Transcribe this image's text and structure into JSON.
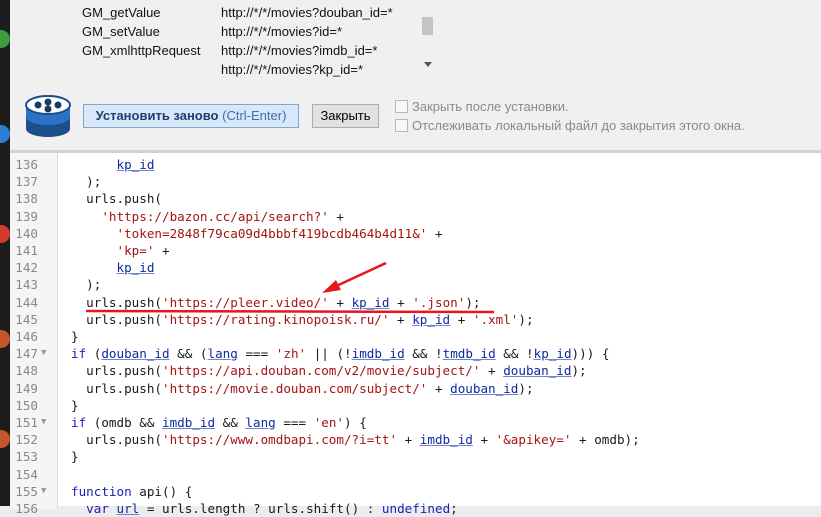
{
  "apis": [
    {
      "fn": "GM_getValue",
      "url": "http://*/*/movies?douban_id=*"
    },
    {
      "fn": "GM_setValue",
      "url": "http://*/*/movies?id=*"
    },
    {
      "fn": "GM_xmlhttpRequest",
      "url": "http://*/*/movies?imdb_id=*"
    },
    {
      "fn": "",
      "url": "http://*/*/movies?kp_id=*"
    }
  ],
  "buttons": {
    "reinstall_label": "Установить заново",
    "reinstall_shortcut": "(Ctrl-Enter)",
    "close_label": "Закрыть"
  },
  "options": {
    "close_after_install": "Закрыть после установки.",
    "track_local_file": "Отслеживать локальный файл до закрытия этого окна."
  },
  "code_lines": [
    {
      "n": "136",
      "fold": "",
      "tokens": [
        [
          "p",
          "      "
        ],
        [
          "v",
          "kp_id"
        ]
      ]
    },
    {
      "n": "137",
      "fold": "",
      "tokens": [
        [
          "p",
          "  );"
        ]
      ]
    },
    {
      "n": "138",
      "fold": "",
      "tokens": [
        [
          "p",
          "  urls.push("
        ]
      ]
    },
    {
      "n": "139",
      "fold": "",
      "tokens": [
        [
          "p",
          "    "
        ],
        [
          "s",
          "'https://bazon.cc/api/search?'"
        ],
        [
          "p",
          " +"
        ]
      ]
    },
    {
      "n": "140",
      "fold": "",
      "tokens": [
        [
          "p",
          "      "
        ],
        [
          "s",
          "'token=2848f79ca09d4bbbf419bcdb464b4d11&'"
        ],
        [
          "p",
          " +"
        ]
      ]
    },
    {
      "n": "141",
      "fold": "",
      "tokens": [
        [
          "p",
          "      "
        ],
        [
          "s",
          "'kp='"
        ],
        [
          "p",
          " +"
        ]
      ]
    },
    {
      "n": "142",
      "fold": "",
      "tokens": [
        [
          "p",
          "      "
        ],
        [
          "v",
          "kp_id"
        ]
      ]
    },
    {
      "n": "143",
      "fold": "",
      "tokens": [
        [
          "p",
          "  );"
        ]
      ]
    },
    {
      "n": "144",
      "fold": "",
      "tokens": [
        [
          "p",
          "  urls.push("
        ],
        [
          "s",
          "'https://pleer.video/'"
        ],
        [
          "p",
          " + "
        ],
        [
          "v",
          "kp_id"
        ],
        [
          "p",
          " + "
        ],
        [
          "s",
          "'.json'"
        ],
        [
          "p",
          ");"
        ]
      ]
    },
    {
      "n": "145",
      "fold": "",
      "tokens": [
        [
          "p",
          "  urls.push("
        ],
        [
          "s",
          "'https://rating.kinopoisk.ru/'"
        ],
        [
          "p",
          " + "
        ],
        [
          "v",
          "kp_id"
        ],
        [
          "p",
          " + "
        ],
        [
          "s",
          "'.xml'"
        ],
        [
          "p",
          ");"
        ]
      ]
    },
    {
      "n": "146",
      "fold": "",
      "tokens": [
        [
          "p",
          "}"
        ]
      ]
    },
    {
      "n": "147",
      "fold": "▼",
      "tokens": [
        [
          "k",
          "if"
        ],
        [
          "p",
          " ("
        ],
        [
          "v",
          "douban_id"
        ],
        [
          "p",
          " && ("
        ],
        [
          "v",
          "lang"
        ],
        [
          "p",
          " === "
        ],
        [
          "s",
          "'zh'"
        ],
        [
          "p",
          " || (!"
        ],
        [
          "v",
          "imdb_id"
        ],
        [
          "p",
          " && !"
        ],
        [
          "v",
          "tmdb_id"
        ],
        [
          "p",
          " && !"
        ],
        [
          "v",
          "kp_id"
        ],
        [
          "p",
          "))) {"
        ]
      ]
    },
    {
      "n": "148",
      "fold": "",
      "tokens": [
        [
          "p",
          "  urls.push("
        ],
        [
          "s",
          "'https://api.douban.com/v2/movie/subject/'"
        ],
        [
          "p",
          " + "
        ],
        [
          "v",
          "douban_id"
        ],
        [
          "p",
          ");"
        ]
      ]
    },
    {
      "n": "149",
      "fold": "",
      "tokens": [
        [
          "p",
          "  urls.push("
        ],
        [
          "s",
          "'https://movie.douban.com/subject/'"
        ],
        [
          "p",
          " + "
        ],
        [
          "v",
          "douban_id"
        ],
        [
          "p",
          ");"
        ]
      ]
    },
    {
      "n": "150",
      "fold": "",
      "tokens": [
        [
          "p",
          "}"
        ]
      ]
    },
    {
      "n": "151",
      "fold": "▼",
      "tokens": [
        [
          "k",
          "if"
        ],
        [
          "p",
          " (omdb && "
        ],
        [
          "v",
          "imdb_id"
        ],
        [
          "p",
          " && "
        ],
        [
          "v",
          "lang"
        ],
        [
          "p",
          " === "
        ],
        [
          "s",
          "'en'"
        ],
        [
          "p",
          ") {"
        ]
      ]
    },
    {
      "n": "152",
      "fold": "",
      "tokens": [
        [
          "p",
          "  urls.push("
        ],
        [
          "s",
          "'https://www.omdbapi.com/?i=tt'"
        ],
        [
          "p",
          " + "
        ],
        [
          "v",
          "imdb_id"
        ],
        [
          "p",
          " + "
        ],
        [
          "s",
          "'&apikey='"
        ],
        [
          "p",
          " + omdb);"
        ]
      ]
    },
    {
      "n": "153",
      "fold": "",
      "tokens": [
        [
          "p",
          "}"
        ]
      ]
    },
    {
      "n": "154",
      "fold": "",
      "tokens": []
    },
    {
      "n": "155",
      "fold": "▼",
      "tokens": [
        [
          "k",
          "function"
        ],
        [
          "p",
          " api() {"
        ]
      ]
    },
    {
      "n": "156",
      "fold": "",
      "tokens": [
        [
          "p",
          "  "
        ],
        [
          "k",
          "var"
        ],
        [
          "p",
          " "
        ],
        [
          "v",
          "url"
        ],
        [
          "p",
          " = urls.length ? urls.shift() : "
        ],
        [
          "k",
          "undefined"
        ],
        [
          "p",
          ";"
        ]
      ]
    }
  ],
  "colors": {
    "annotation": "#e8141e",
    "keyword": "#1d1db8",
    "string": "#a31515",
    "variable": "#0d2b9e"
  }
}
